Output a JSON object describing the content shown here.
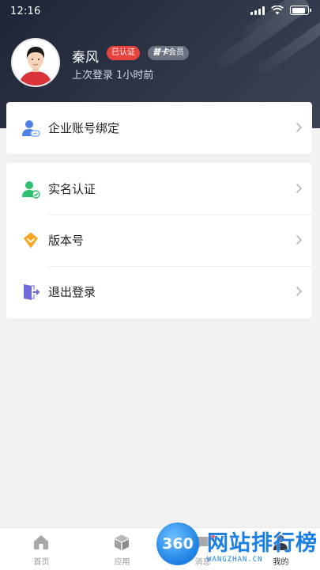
{
  "status_bar": {
    "time": "12:16"
  },
  "profile": {
    "name": "秦风",
    "verified_badge": "已认证",
    "member_badge_brand": "普卡",
    "member_badge_text": "会员",
    "last_login": "上次登录 1小时前"
  },
  "menu_group_1": [
    {
      "label": "企业账号绑定",
      "icon": "enterprise-bind-icon"
    }
  ],
  "menu_group_2": [
    {
      "label": "实名认证",
      "icon": "real-name-verify-icon"
    },
    {
      "label": "版本号",
      "icon": "version-icon"
    },
    {
      "label": "退出登录",
      "icon": "logout-icon"
    }
  ],
  "tab_bar": [
    {
      "label": "首页",
      "icon": "home-icon"
    },
    {
      "label": "应用",
      "icon": "apps-icon"
    },
    {
      "label": "消息",
      "icon": "message-icon"
    },
    {
      "label": "我的",
      "icon": "profile-icon",
      "active": true
    }
  ],
  "watermark": {
    "logo_text": "360",
    "title": "网站排行榜",
    "subtitle": "WANGZHAN.CN"
  },
  "colors": {
    "header_bg": "#2e3648",
    "badge_red": "#e8423f",
    "badge_gray": "#6d7280",
    "icon_blue": "#4f7fe8",
    "icon_green": "#2fbf71",
    "icon_orange": "#f5a623",
    "icon_purple": "#6f6ad8"
  }
}
